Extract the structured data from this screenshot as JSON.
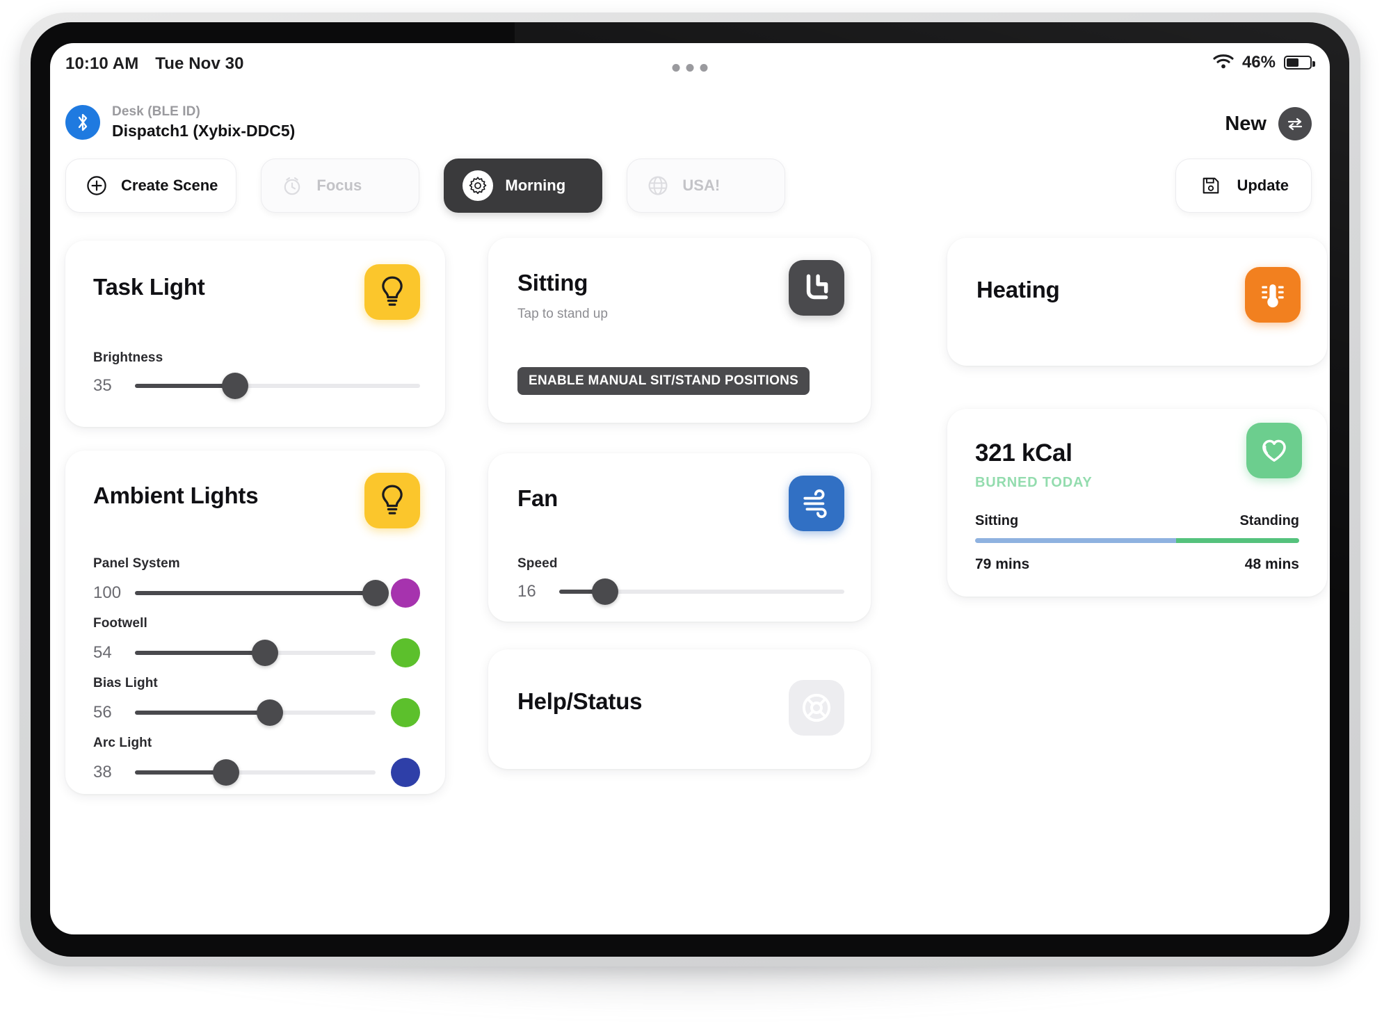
{
  "statusbar": {
    "time": "10:10 AM",
    "date": "Tue Nov 30",
    "battery_percent": "46%",
    "wifi_icon": "wifi-icon",
    "battery_icon": "battery-icon",
    "menu_icon": "more-dots-icon"
  },
  "device": {
    "label": "Desk (BLE ID)",
    "name": "Dispatch1 (Xybix-DDC5)",
    "bluetooth_icon": "bluetooth-icon"
  },
  "header_actions": {
    "new_label": "New",
    "new_icon": "swap-arrows-icon",
    "update_label": "Update",
    "update_icon": "save-floppy-icon"
  },
  "scenes": [
    {
      "label": "Create Scene",
      "icon": "plus-circle-icon",
      "state": "default"
    },
    {
      "label": "Focus",
      "icon": "alarm-clock-icon",
      "state": "dim"
    },
    {
      "label": "Morning",
      "icon": "gear-icon",
      "state": "active"
    },
    {
      "label": "USA!",
      "icon": "globe-icon",
      "state": "dim"
    }
  ],
  "cards": {
    "task_light": {
      "title": "Task Light",
      "icon": "lightbulb-icon",
      "icon_color": "#fbc62c",
      "slider": {
        "name": "Brightness",
        "value": "35",
        "percent": 35
      }
    },
    "ambient_lights": {
      "title": "Ambient Lights",
      "icon": "lightbulb-icon",
      "icon_color": "#fbc62c",
      "sliders": [
        {
          "name": "Panel System",
          "value": "100",
          "percent": 100,
          "color": "#a633ae"
        },
        {
          "name": "Footwell",
          "value": "54",
          "percent": 54,
          "color": "#5cc02c"
        },
        {
          "name": "Bias Light",
          "value": "56",
          "percent": 56,
          "color": "#5cc02c"
        },
        {
          "name": "Arc Light",
          "value": "38",
          "percent": 38,
          "color": "#2e3fa8"
        }
      ]
    },
    "sitting": {
      "title": "Sitting",
      "subtitle": "Tap to stand up",
      "icon": "sit-desk-icon",
      "icon_color": "#4a4a4d",
      "pill_label": "ENABLE MANUAL SIT/STAND POSITIONS"
    },
    "fan": {
      "title": "Fan",
      "icon": "wind-icon",
      "icon_color": "#3170c4",
      "slider": {
        "name": "Speed",
        "value": "16",
        "percent": 16
      }
    },
    "help_status": {
      "title": "Help/Status",
      "icon": "lifebuoy-icon",
      "icon_color": "#ededf0"
    },
    "heating": {
      "title": "Heating",
      "icon": "thermometer-icon",
      "icon_color": "#f2801f"
    },
    "activity": {
      "value": "321 kCal",
      "caption": "BURNED TODAY",
      "icon": "heart-icon",
      "icon_color": "#6cce8e",
      "left_label": "Sitting",
      "right_label": "Standing",
      "left_mins": "79 mins",
      "right_mins": "48 mins",
      "left_percent": 62,
      "right_percent": 38,
      "left_color": "#8fb2e0",
      "right_color": "#55c27d"
    }
  }
}
